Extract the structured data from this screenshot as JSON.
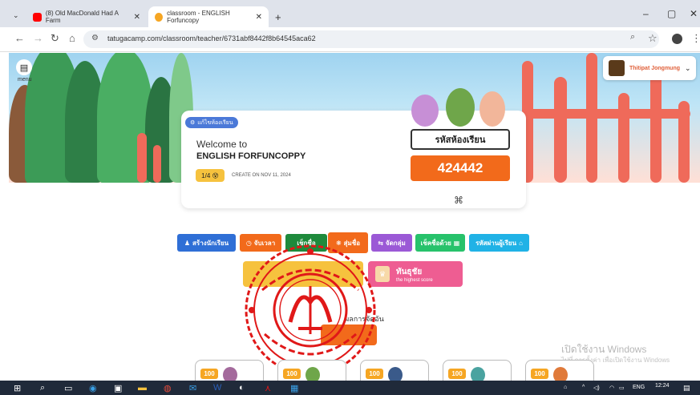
{
  "browser": {
    "tabs": [
      {
        "label": "(8) Old MacDonald Had A Farm",
        "icon": "youtube-icon",
        "color": "#ff0000"
      },
      {
        "label": "classroom - ENGLISH Forfuncopy",
        "icon": "tatuga-icon",
        "color": "#f6a623"
      }
    ],
    "new_tab": "+",
    "url": "tatugacamp.com/classroom/teacher/6731abf8442f8b64545aca62"
  },
  "header": {
    "menu_label": "menu",
    "user_name": "Thitipat Jongmung"
  },
  "classroom_card": {
    "chip_label": "แก้ไขห้องเรียน",
    "welcome": "Welcome to",
    "name": "ENGLISH FORFUNCOPPY",
    "level": "1/4 😵",
    "created": "CREATE ON NOV 11, 2024",
    "code_label": "รหัสห้องเรียน",
    "code": "424442"
  },
  "actions": [
    {
      "label": "สร้างนักเรียน",
      "color": "#2f6fd6"
    },
    {
      "label": "จับเวลา",
      "color": "#f26a1b"
    },
    {
      "label": "เช็กชื่อ",
      "color": "#1e8a3c"
    },
    {
      "label": "สุ่มชื่อ",
      "color": "#f26a1b"
    },
    {
      "label": "จัดกลุ่ม",
      "color": "#9b59d6"
    },
    {
      "label": "เช็คชื่อด้วย",
      "color": "#27c26b"
    },
    {
      "label": "รหัสผ่านผู้เรียน",
      "color": "#20b2e6"
    }
  ],
  "highest": {
    "title": "ทันธุชัย",
    "subtitle": "the highest score",
    "color": "#ee5d92"
  },
  "obscured_text": "ผลการจัดอัน",
  "students": [
    {
      "score": "100"
    },
    {
      "score": "100"
    },
    {
      "score": "100"
    },
    {
      "score": "100"
    },
    {
      "score": "100"
    }
  ],
  "watermark": {
    "line1": "เปิดใช้งาน Windows",
    "line2": "ไปที่ การตั้งค่า เพื่อเปิดใช้งาน Windows"
  },
  "taskbar": {
    "lang": "ENG",
    "time": "12:24"
  }
}
